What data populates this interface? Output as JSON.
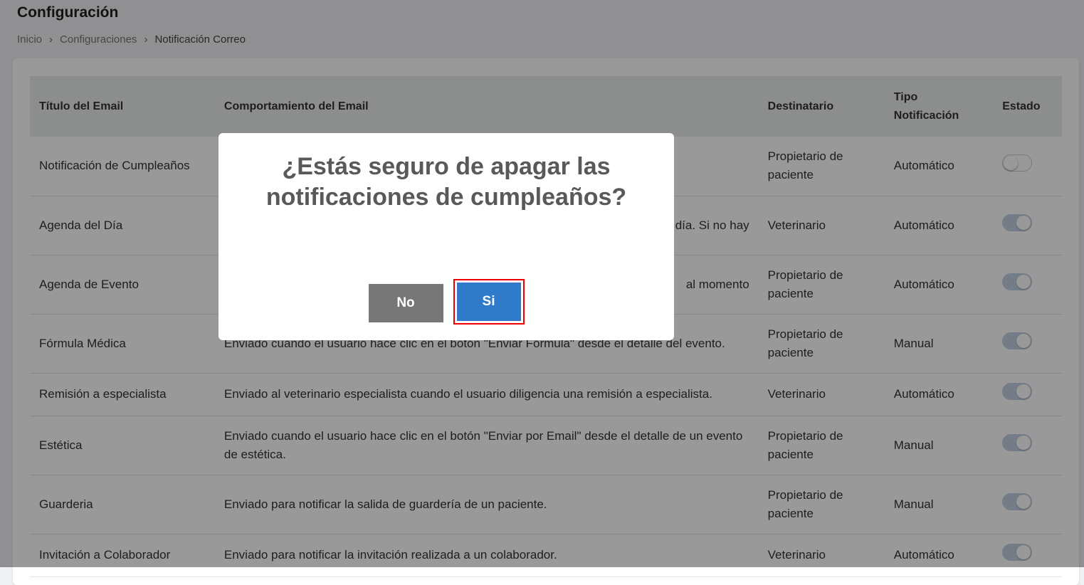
{
  "page": {
    "title": "Configuración",
    "breadcrumb": [
      "Inicio",
      "Configuraciones",
      "Notificación Correo"
    ]
  },
  "table": {
    "headers": [
      "Título del Email",
      "Comportamiento del Email",
      "Destinatario",
      "Tipo Notificación",
      "Estado"
    ],
    "rows": [
      {
        "title": "Notificación de Cumpleaños",
        "behavior": "",
        "recipient": "Propietario de paciente",
        "type": "Automático",
        "enabled": false
      },
      {
        "title": "Agenda del Día",
        "behavior": "día. Si no hay",
        "recipient": "Veterinario",
        "type": "Automático",
        "enabled": true
      },
      {
        "title": "Agenda de Evento",
        "behavior": "al momento",
        "recipient": "Propietario de paciente",
        "type": "Automático",
        "enabled": true
      },
      {
        "title": "Fórmula Médica",
        "behavior": "Enviado cuando el usuario hace clic en el botón \"Enviar Fórmula\" desde el detalle del evento.",
        "recipient": "Propietario de paciente",
        "type": "Manual",
        "enabled": true
      },
      {
        "title": "Remisión a especialista",
        "behavior": "Enviado al veterinario especialista cuando el usuario diligencia una remisión a especialista.",
        "recipient": "Veterinario",
        "type": "Automático",
        "enabled": true
      },
      {
        "title": "Estética",
        "behavior": "Enviado cuando el usuario hace clic en el botón \"Enviar por Email\" desde el detalle de un evento de estética.",
        "recipient": "Propietario de paciente",
        "type": "Manual",
        "enabled": true
      },
      {
        "title": "Guarderia",
        "behavior": "Enviado para notificar la salida de guardería de un paciente.",
        "recipient": "Propietario de paciente",
        "type": "Manual",
        "enabled": true
      },
      {
        "title": "Invitación a Colaborador",
        "behavior": "Enviado para notificar la invitación realizada a un colaborador.",
        "recipient": "Veterinario",
        "type": "Automático",
        "enabled": true
      }
    ]
  },
  "modal": {
    "question": "¿Estás seguro de apagar las notificaciones de cumpleaños?",
    "no_label": "No",
    "yes_label": "Si"
  },
  "colors": {
    "primary": "#2f7ac9",
    "secondary": "#777777",
    "highlight": "#ee0000"
  }
}
